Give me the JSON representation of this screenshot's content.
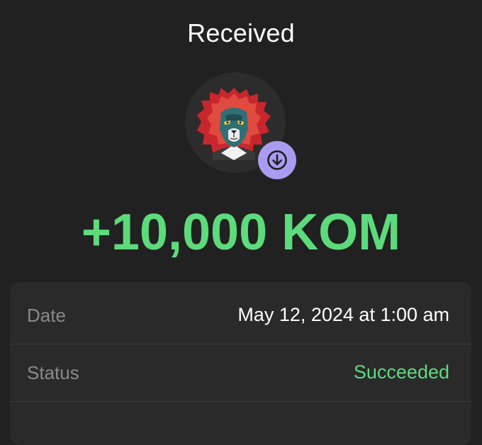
{
  "header": {
    "title": "Received"
  },
  "transaction": {
    "amount": "+10,000 KOM",
    "direction_icon": "arrow-down-icon",
    "avatar": "lion-avatar"
  },
  "details": {
    "date_label": "Date",
    "date_value": "May 12, 2024 at 1:00 am",
    "status_label": "Status",
    "status_value": "Succeeded"
  },
  "colors": {
    "background": "#212121",
    "card": "#2a2a2a",
    "accent_green": "#5ddb7c",
    "badge_purple": "#a89bf0",
    "label_gray": "#8a8a8a"
  }
}
